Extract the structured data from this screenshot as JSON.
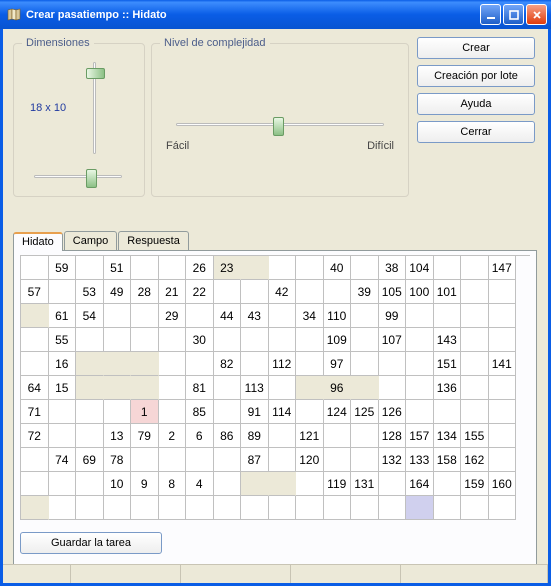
{
  "window": {
    "title": "Crear pasatiempo :: Hidato"
  },
  "dimensions": {
    "legend": "Dimensiones",
    "value": "18 x 10"
  },
  "complexity": {
    "legend": "Nivel de complejidad",
    "easy": "Fácil",
    "hard": "Difícil"
  },
  "buttons": {
    "create": "Crear",
    "batch": "Creación por lote",
    "help": "Ayuda",
    "close": "Cerrar",
    "save": "Guardar la tarea"
  },
  "tabs": {
    "hidato": "Hidato",
    "campo": "Campo",
    "respuesta": "Respuesta"
  },
  "grid": {
    "cols": 18,
    "rows": 11,
    "blocked": [
      [
        0,
        7
      ],
      [
        0,
        8
      ],
      [
        2,
        0
      ],
      [
        4,
        2
      ],
      [
        4,
        3
      ],
      [
        4,
        4
      ],
      [
        5,
        2
      ],
      [
        5,
        3
      ],
      [
        5,
        4
      ],
      [
        5,
        10
      ],
      [
        5,
        11
      ],
      [
        5,
        12
      ],
      [
        9,
        8
      ],
      [
        9,
        9
      ],
      [
        10,
        0
      ]
    ],
    "hl": {
      "1": [
        6,
        4
      ],
      "164": [
        10,
        14
      ]
    },
    "cells": [
      [
        "",
        "59",
        "",
        "51",
        "",
        "",
        "26",
        "23",
        "",
        "",
        "",
        "40",
        "",
        "38",
        "104",
        "",
        "",
        "147"
      ],
      [
        "57",
        "",
        "53",
        "49",
        "28",
        "21",
        "22",
        "",
        "",
        "42",
        "",
        "",
        "39",
        "105",
        "100",
        "101",
        "",
        ""
      ],
      [
        "",
        "61",
        "54",
        "",
        "",
        "29",
        "",
        "44",
        "43",
        "",
        "34",
        "110",
        "",
        "99",
        "",
        "",
        "",
        ""
      ],
      [
        "",
        "55",
        "",
        "",
        "",
        "",
        "30",
        "",
        "",
        "",
        "",
        "109",
        "",
        "107",
        "",
        "143",
        "",
        ""
      ],
      [
        "",
        "16",
        "",
        "",
        "",
        "",
        "",
        "82",
        "",
        "112",
        "",
        "97",
        "",
        "",
        "",
        "151",
        "",
        "141"
      ],
      [
        "64",
        "15",
        "",
        "",
        "",
        "",
        "81",
        "",
        "113",
        "",
        "",
        "96",
        "",
        "",
        "",
        "136",
        "",
        ""
      ],
      [
        "71",
        "",
        "",
        "",
        "1",
        "",
        "85",
        "",
        "91",
        "114",
        "",
        "124",
        "125",
        "126",
        "",
        "",
        "",
        ""
      ],
      [
        "72",
        "",
        "",
        "13",
        "79",
        "2",
        "6",
        "86",
        "89",
        "",
        "121",
        "",
        "",
        "128",
        "157",
        "134",
        "155",
        ""
      ],
      [
        "",
        "74",
        "69",
        "78",
        "",
        "",
        "",
        "",
        "87",
        "",
        "120",
        "",
        "",
        "132",
        "133",
        "158",
        "162",
        ""
      ],
      [
        "",
        "",
        "",
        "10",
        "9",
        "8",
        "4",
        "",
        "",
        "",
        "",
        "119",
        "131",
        "",
        "164",
        "",
        "159",
        "160"
      ]
    ]
  }
}
